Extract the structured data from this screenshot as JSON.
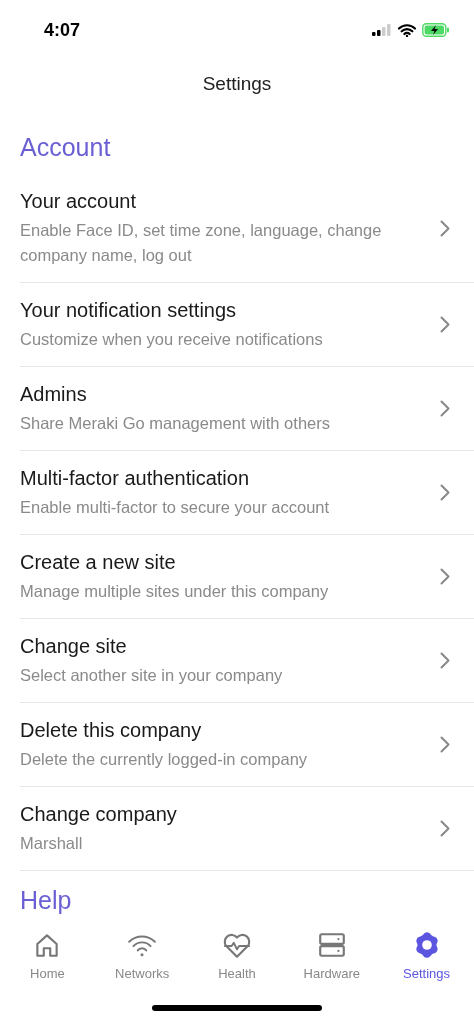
{
  "status_bar": {
    "time": "4:07"
  },
  "header": {
    "title": "Settings"
  },
  "sections": [
    {
      "title": "Account",
      "items": [
        {
          "title": "Your account",
          "subtitle": "Enable Face ID, set time zone, language, change company name, log out"
        },
        {
          "title": "Your notification settings",
          "subtitle": "Customize when you receive notifications"
        },
        {
          "title": "Admins",
          "subtitle": "Share Meraki Go management with others"
        },
        {
          "title": "Multi-factor authentication",
          "subtitle": "Enable multi-factor to secure your account"
        },
        {
          "title": "Create a new site",
          "subtitle": "Manage multiple sites under this company"
        },
        {
          "title": "Change site",
          "subtitle": "Select another site in your company"
        },
        {
          "title": "Delete this company",
          "subtitle": "Delete the currently logged-in company"
        },
        {
          "title": "Change company",
          "subtitle": "Marshall"
        }
      ]
    },
    {
      "title": "Help"
    }
  ],
  "tab_bar": [
    {
      "label": "Home",
      "kind": "home",
      "selected": false
    },
    {
      "label": "Networks",
      "kind": "wifi",
      "selected": false
    },
    {
      "label": "Health",
      "kind": "heart",
      "selected": false
    },
    {
      "label": "Hardware",
      "kind": "server",
      "selected": false
    },
    {
      "label": "Settings",
      "kind": "gear",
      "selected": true
    }
  ]
}
